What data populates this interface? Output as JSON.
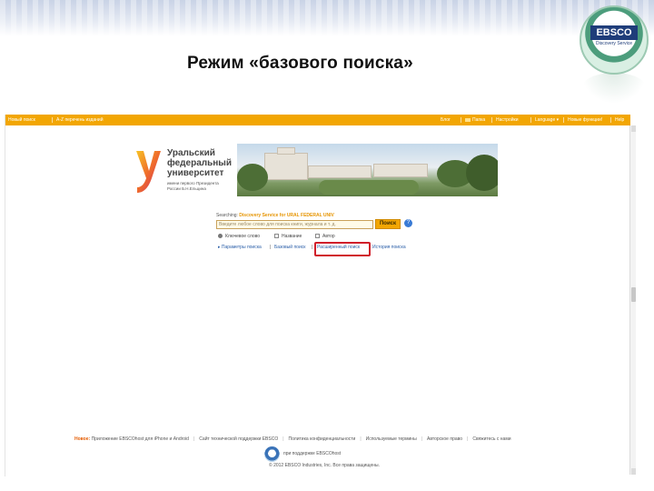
{
  "slide": {
    "title": "Режим «базового поиска»",
    "logo": {
      "word": "EBSCO",
      "sub": "Discovery Service"
    }
  },
  "navbar": {
    "left": [
      "Новый поиск",
      "А-Z перечень изданий"
    ],
    "right": [
      "Блог",
      "Папка",
      "Настройки",
      "Language ▾",
      "Новые функции!",
      "Help"
    ]
  },
  "institution": {
    "name_lines": [
      "Уральский",
      "федеральный",
      "университет"
    ],
    "sub_lines": [
      "имени первого Президента",
      "России Б.Н.Ельцина"
    ]
  },
  "search": {
    "searching_label": "Searching:",
    "source": "Discovery Service for URAL FEDERAL UNIV",
    "placeholder": "Введите любое слово для поиска книги, журнала и т. д.",
    "button": "Поиск",
    "help_glyph": "?",
    "options": [
      "Ключевое слово",
      "Название",
      "Автор"
    ],
    "links": [
      "▸ Параметры поиска",
      "Базовый поиск",
      "Расширенный поиск",
      "История поиска"
    ],
    "separator": "|"
  },
  "footer": {
    "lead": "Новое:",
    "links": [
      "Приложение EBSCOhost для iPhone и Android",
      "Сайт технической поддержки EBSCO",
      "Политика конфиденциальности",
      "Используемые термины",
      "Авторское право",
      "Свяжитесь с нами"
    ],
    "separator": "|",
    "powered": "при поддержке EBSCOhost",
    "copyright": "© 2012 EBSCO Industries, Inc. Все права защищены."
  },
  "colors": {
    "navbar": "#f2a603",
    "highlight": "#d01f2a",
    "link": "#2a5ea8",
    "ebsco_blue": "#1f3d7a"
  }
}
